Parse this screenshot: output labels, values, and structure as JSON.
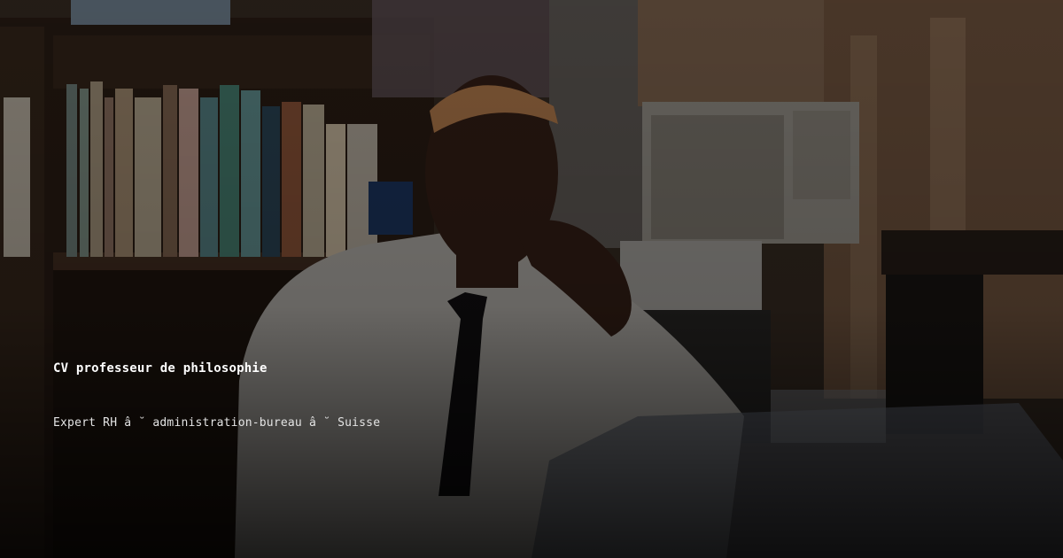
{
  "card": {
    "title": "CV professeur de philosophie",
    "subtitle": "Expert RH â ˘ administration-bureau â ˘ Suisse"
  },
  "background_image": {
    "overlay_color": "#000000",
    "title_color": "#ffffff",
    "subtitle_color": "#e4e4e4"
  }
}
